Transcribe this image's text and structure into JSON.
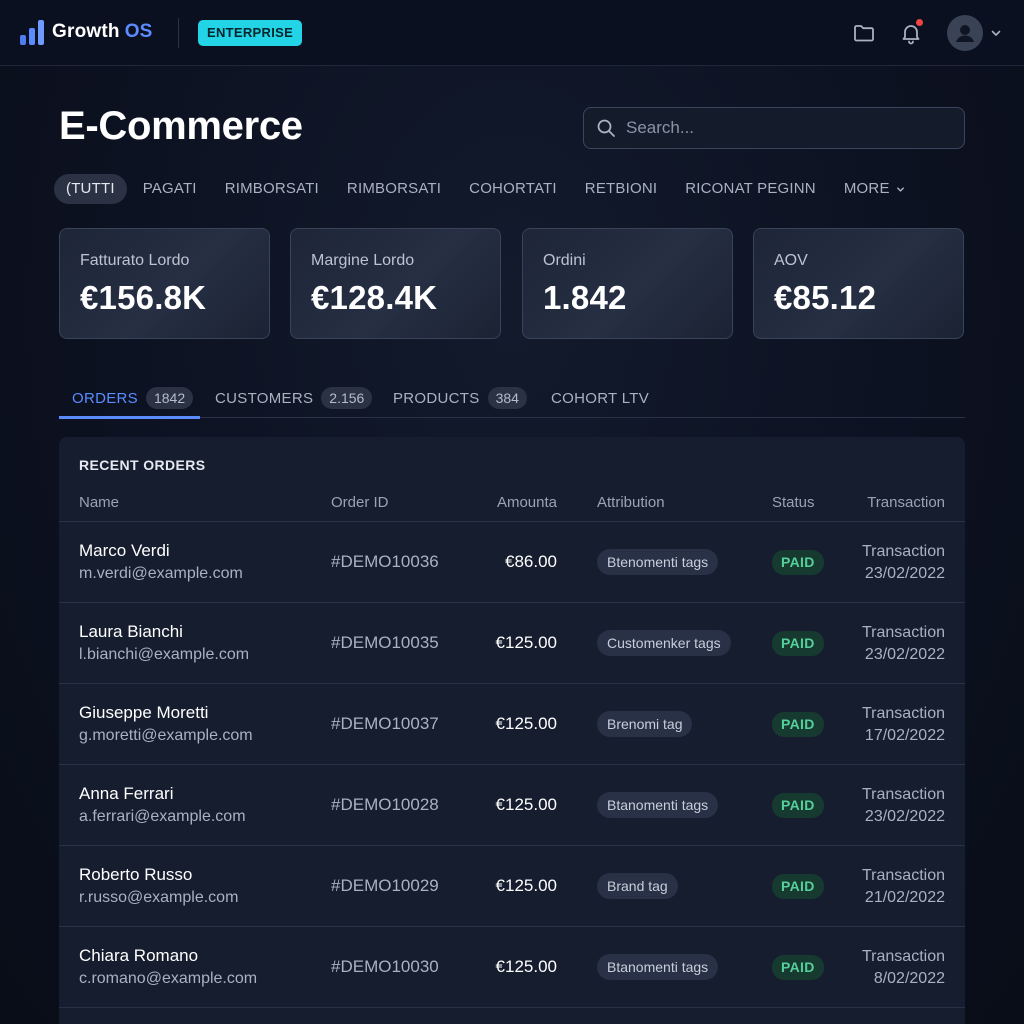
{
  "header": {
    "brand_name": "Growth",
    "brand_suffix": "OS",
    "plan_badge": "ENTERPRISE",
    "icons": [
      "logo-bars-icon",
      "folder-icon",
      "bell-icon",
      "user-avatar-icon",
      "chevron-down-icon"
    ],
    "notification_dot_color": "#ef4444"
  },
  "page": {
    "title": "E-Commerce",
    "search_placeholder": "Search..."
  },
  "filters": [
    {
      "label": "(TUTTI",
      "active": true
    },
    {
      "label": "PAGATI",
      "active": false
    },
    {
      "label": "RIMBORSATI",
      "active": false
    },
    {
      "label": "RIMBORSATI",
      "active": false
    },
    {
      "label": "COHORTATI",
      "active": false
    },
    {
      "label": "RETBIONI",
      "active": false
    },
    {
      "label": "RICONAT PEGINN",
      "active": false
    },
    {
      "label": "MORE",
      "active": false
    }
  ],
  "kpis": [
    {
      "label": "Fatturato Lordo",
      "value": "€156.8K"
    },
    {
      "label": "Margine Lordo",
      "value": "€128.4K"
    },
    {
      "label": "Ordini",
      "value": "1.842"
    },
    {
      "label": "AOV",
      "value": "€85.12"
    }
  ],
  "tabs": [
    {
      "label": "ORDERS",
      "count": "1842",
      "active": true
    },
    {
      "label": "CUSTOMERS",
      "count": "2.156",
      "active": false
    },
    {
      "label": "PRODUCTS",
      "count": "384",
      "active": false
    },
    {
      "label": "COHORT LTV",
      "count": "",
      "active": false
    }
  ],
  "table": {
    "title": "RECENT ORDERS",
    "columns": [
      "Name",
      "Order ID",
      "Amounta",
      "Attribution",
      "Status",
      "Transaction"
    ],
    "rows": [
      {
        "name": "Marco Verdi",
        "email": "m.verdi@example.com",
        "order_id": "#DEMO10036",
        "amount": "€86.00",
        "attribution": "Btenomenti tags",
        "status": "PAID",
        "tx_label": "Transaction",
        "tx_date": "23/02/2022"
      },
      {
        "name": "Laura Bianchi",
        "email": "l.bianchi@example.com",
        "order_id": "#DEMO10035",
        "amount": "€125.00",
        "attribution": "Customenker tags",
        "status": "PAID",
        "tx_label": "Transaction",
        "tx_date": "23/02/2022"
      },
      {
        "name": "Giuseppe Moretti",
        "email": "g.moretti@example.com",
        "order_id": "#DEMO10037",
        "amount": "€125.00",
        "attribution": "Brenomi tag",
        "status": "PAID",
        "tx_label": "Transaction",
        "tx_date": "17/02/2022"
      },
      {
        "name": "Anna Ferrari",
        "email": "a.ferrari@example.com",
        "order_id": "#DEMO10028",
        "amount": "€125.00",
        "attribution": "Btanomenti tags",
        "status": "PAID",
        "tx_label": "Transaction",
        "tx_date": "23/02/2022"
      },
      {
        "name": "Roberto Russo",
        "email": "r.russo@example.com",
        "order_id": "#DEMO10029",
        "amount": "€125.00",
        "attribution": "Brand tag",
        "status": "PAID",
        "tx_label": "Transaction",
        "tx_date": "21/02/2022"
      },
      {
        "name": "Chiara Romano",
        "email": "c.romano@example.com",
        "order_id": "#DEMO10030",
        "amount": "€125.00",
        "attribution": "Btanomenti tags",
        "status": "PAID",
        "tx_label": "Transaction",
        "tx_date": "8/02/2022"
      }
    ]
  },
  "colors": {
    "accent": "#5b8cff",
    "badge_cyan": "#23d3e6",
    "status_paid": "#56d09a",
    "background": "#0c1120"
  }
}
